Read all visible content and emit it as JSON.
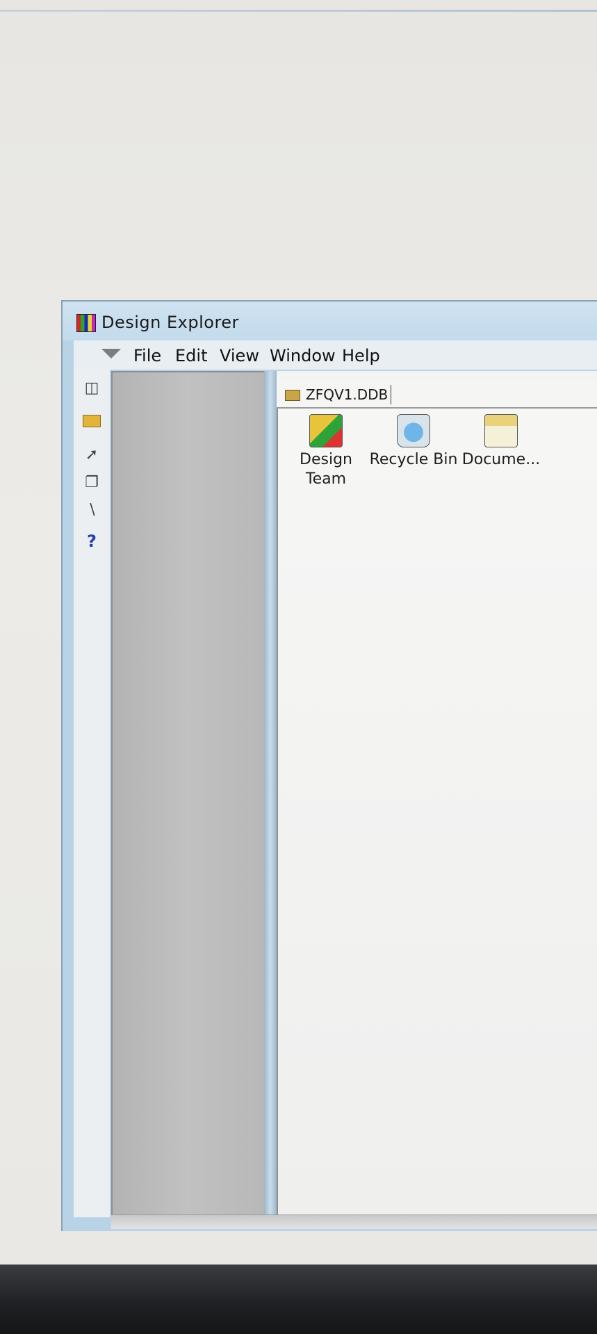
{
  "window": {
    "title": "Design Explorer"
  },
  "menu": {
    "items": [
      {
        "label": "File"
      },
      {
        "label": "Edit"
      },
      {
        "label": "View"
      },
      {
        "label": "Window"
      },
      {
        "label": "Help"
      }
    ]
  },
  "toolbar": {
    "icons": [
      "explorer-icon",
      "open-folder-icon",
      "wire-tool-icon",
      "copy-icon",
      "pencil-icon",
      "help-icon"
    ],
    "help_glyph": "?"
  },
  "tab": {
    "label": "ZFQV1.DDB"
  },
  "items": [
    {
      "label": "Design\nTeam",
      "icon": "design-team-icon"
    },
    {
      "label": "Recycle Bin",
      "icon": "recycle-bin-icon"
    },
    {
      "label": "Docume...",
      "icon": "documents-folder-icon"
    }
  ]
}
